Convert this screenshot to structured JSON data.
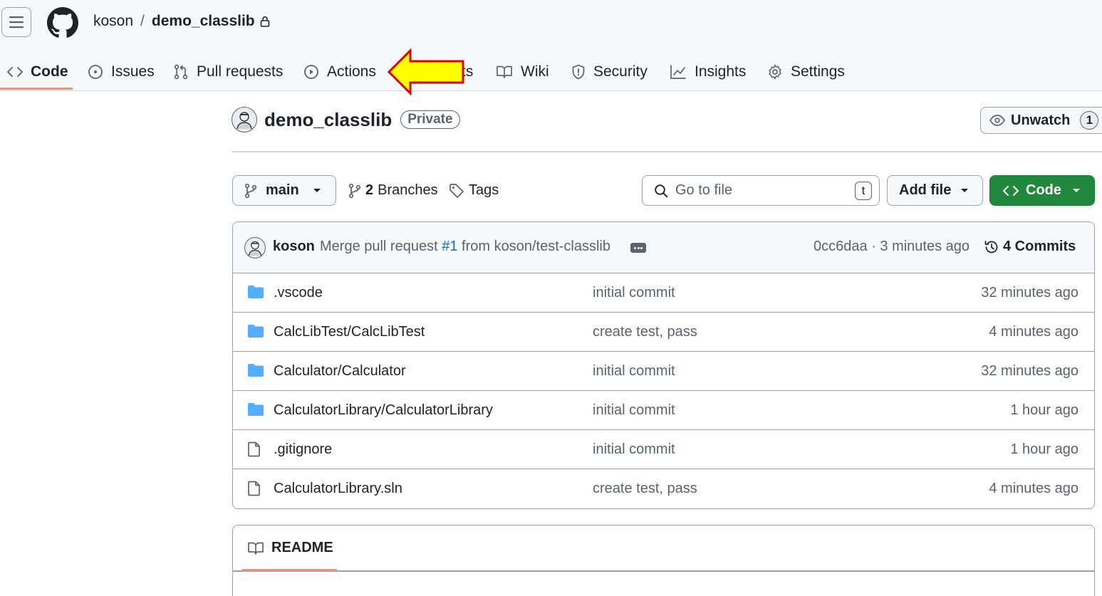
{
  "header": {
    "owner": "koson",
    "separator": "/",
    "repo": "demo_classlib"
  },
  "tabs": [
    {
      "label": "Code",
      "icon": "code-icon",
      "active": true
    },
    {
      "label": "Issues",
      "icon": "issue-opened-icon"
    },
    {
      "label": "Pull requests",
      "icon": "git-pull-request-icon"
    },
    {
      "label": "Actions",
      "icon": "play-icon"
    },
    {
      "label": "ts",
      "icon": "none"
    },
    {
      "label": "Wiki",
      "icon": "book-icon"
    },
    {
      "label": "Security",
      "icon": "shield-icon"
    },
    {
      "label": "Insights",
      "icon": "graph-icon"
    },
    {
      "label": "Settings",
      "icon": "gear-icon"
    }
  ],
  "annotation": {
    "arrow_color": "#ffff00",
    "arrow_outline": "#e00000"
  },
  "repo_head": {
    "title": "demo_classlib",
    "visibility": "Private",
    "unwatch_label": "Unwatch",
    "watch_count": "1"
  },
  "toolbar": {
    "branch": "main",
    "branches_count": "2",
    "branches_label": "Branches",
    "tags_label": "Tags",
    "search_placeholder": "Go to file",
    "search_shortcut": "t",
    "add_file_label": "Add file",
    "code_label": "Code",
    "code_button_color": "#1f883d"
  },
  "latest_commit": {
    "author": "koson",
    "message_prefix": "Merge pull request",
    "pr_number": "#1",
    "message_suffix": "from koson/test-classlib",
    "meta": "0cc6daa · 3 minutes ago",
    "commits_label": "4 Commits"
  },
  "files": [
    {
      "type": "folder",
      "name": ".vscode",
      "message": "initial commit",
      "time": "32 minutes ago"
    },
    {
      "type": "folder",
      "name": "CalcLibTest/CalcLibTest",
      "message": "create test, pass",
      "time": "4 minutes ago"
    },
    {
      "type": "folder",
      "name": "Calculator/Calculator",
      "message": "initial commit",
      "time": "32 minutes ago"
    },
    {
      "type": "folder",
      "name": "CalculatorLibrary/CalculatorLibrary",
      "message": "initial commit",
      "time": "1 hour ago"
    },
    {
      "type": "file",
      "name": ".gitignore",
      "message": "initial commit",
      "time": "1 hour ago"
    },
    {
      "type": "file",
      "name": "CalculatorLibrary.sln",
      "message": "create test, pass",
      "time": "4 minutes ago"
    }
  ],
  "readme": {
    "label": "README"
  }
}
